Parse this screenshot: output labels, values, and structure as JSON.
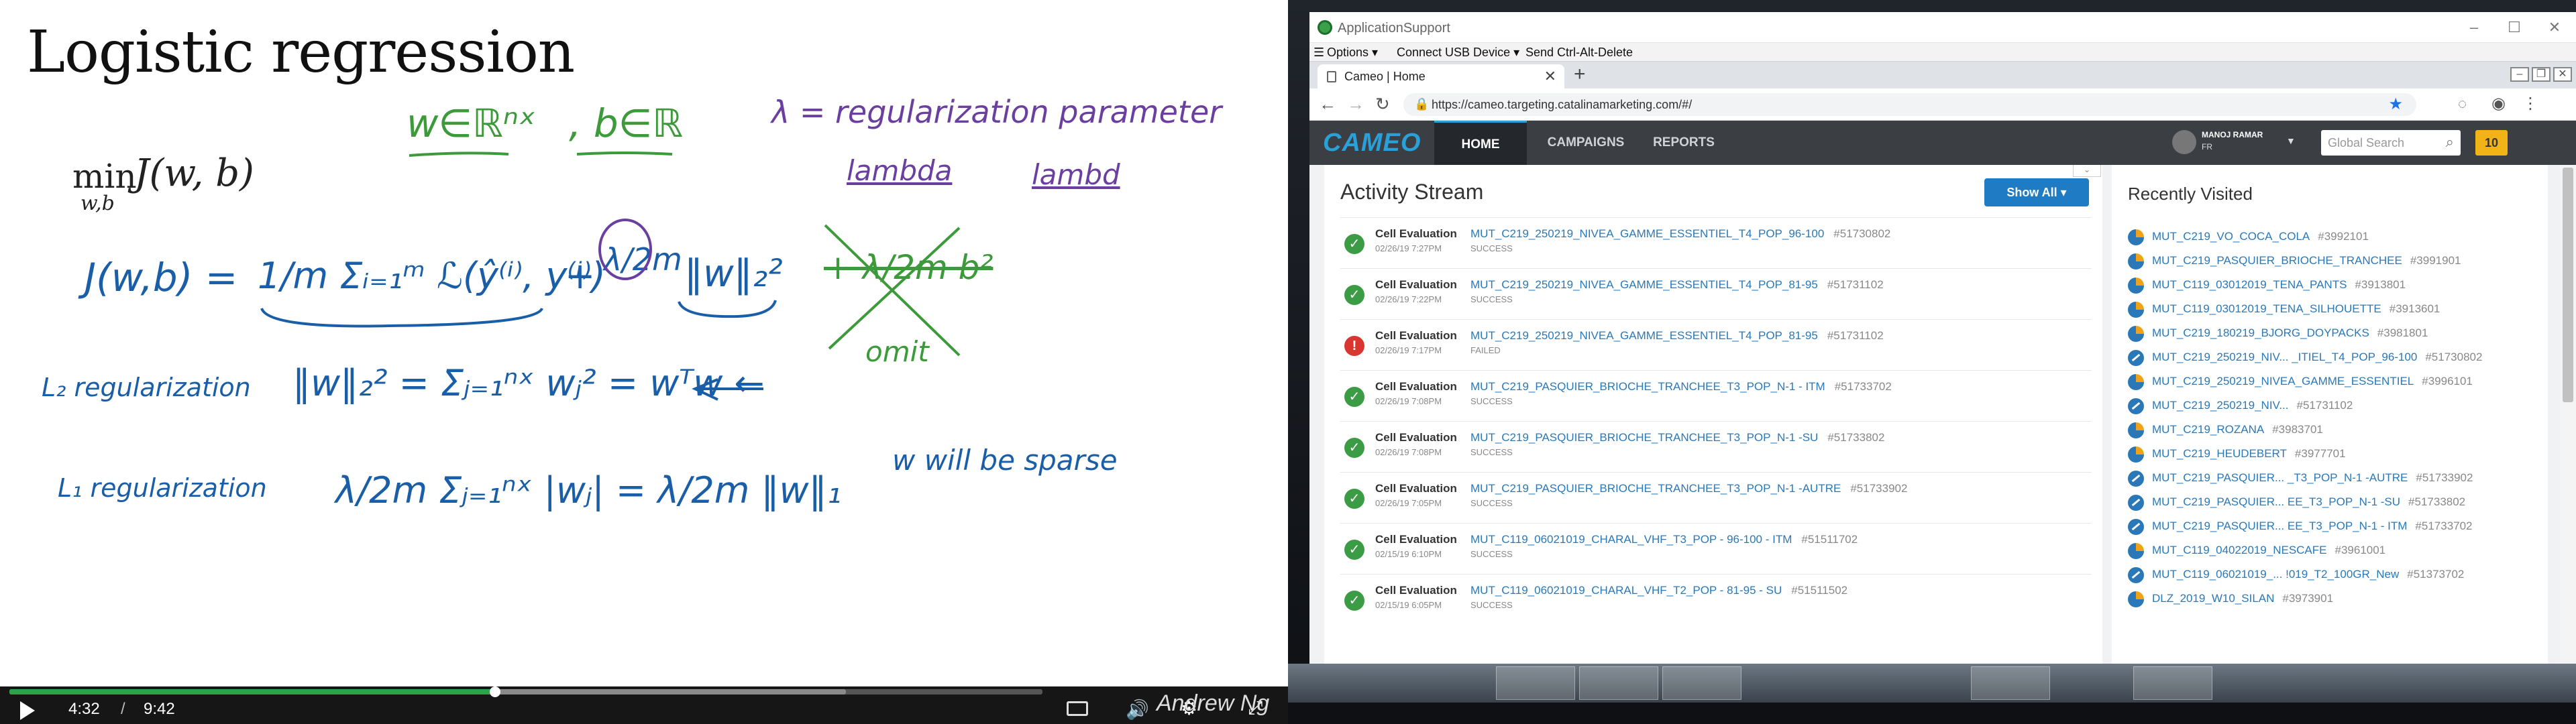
{
  "lecture": {
    "title": "Logistic regression",
    "objective_min": "min",
    "objective_sub": "w,b",
    "objective_expr": "J(w, b)",
    "notes": {
      "w_domain": "w∈ℝⁿˣ",
      "b_domain": ", b∈ℝ",
      "lambda_def": "λ = regularization parameter",
      "lambda_word": "lambda",
      "lambd_word": "lambd",
      "cost_lhs": "J(w,b) = ",
      "cost_sum": "1/m Σᵢ₌₁ᵐ ℒ(ŷ⁽ⁱ⁾, y⁽ⁱ⁾)",
      "cost_plus": "+",
      "cost_lambda": "λ/2m",
      "cost_norm": "‖w‖₂²",
      "omit_term": "+ λ/2m b²",
      "omit_label": "omit",
      "l2_label": "L₂ regularization",
      "l2_formula": "‖w‖₂² = Σⱼ₌₁ⁿˣ wⱼ² = wᵀw ←",
      "l1_label": "L₁ regularization",
      "l1_formula": "λ/2m Σⱼ₌₁ⁿˣ |wⱼ| = λ/2m ‖w‖₁",
      "sparse_note": "w will be sparse"
    },
    "player": {
      "current_time": "4:32",
      "separator": "/",
      "total_time": "9:42",
      "played_fraction": 0.47,
      "buffered_fraction": 0.81,
      "presenter": "Andrew Ng"
    }
  },
  "app_window": {
    "title": "ApplicationSupport",
    "window_controls": [
      "–",
      "☐",
      "✕"
    ],
    "menu": {
      "options": "Options ▾",
      "usb": "Connect USB Device ▾",
      "cad": "Send Ctrl-Alt-Delete"
    }
  },
  "browser": {
    "tab_title": "Cameo | Home",
    "tab_close": "✕",
    "new_tab": "+",
    "url": "https://cameo.targeting.catalinamarketing.com/#/",
    "nav_icons": [
      "back-icon",
      "forward-icon",
      "reload-icon"
    ]
  },
  "cameo": {
    "logo": "CAMEO",
    "nav": [
      "HOME",
      "CAMPAIGNS",
      "REPORTS"
    ],
    "active_nav": "HOME",
    "user_name": "MANOJ RAMAR",
    "user_locale": "FR",
    "search_placeholder": "Global Search",
    "notification_count": "10",
    "activity": {
      "heading": "Activity Stream",
      "show_all": "Show All ▾",
      "rows": [
        {
          "type": "Cell Evaluation",
          "name": "MUT_C219_250219_NIVEA_GAMME_ESSENTIEL_T4_POP_96-100",
          "id": "#51730802",
          "time": "02/26/19 7:27PM",
          "state": "SUCCESS",
          "status": "ok"
        },
        {
          "type": "Cell Evaluation",
          "name": "MUT_C219_250219_NIVEA_GAMME_ESSENTIEL_T4_POP_81-95",
          "id": "#51731102",
          "time": "02/26/19 7:22PM",
          "state": "SUCCESS",
          "status": "ok"
        },
        {
          "type": "Cell Evaluation",
          "name": "MUT_C219_250219_NIVEA_GAMME_ESSENTIEL_T4_POP_81-95",
          "id": "#51731102",
          "time": "02/26/19 7:17PM",
          "state": "FAILED",
          "status": "fail"
        },
        {
          "type": "Cell Evaluation",
          "name": "MUT_C219_PASQUIER_BRIOCHE_TRANCHEE_T3_POP_N-1 - ITM",
          "id": "#51733702",
          "time": "02/26/19 7:08PM",
          "state": "SUCCESS",
          "status": "ok"
        },
        {
          "type": "Cell Evaluation",
          "name": "MUT_C219_PASQUIER_BRIOCHE_TRANCHEE_T3_POP_N-1 -SU",
          "id": "#51733802",
          "time": "02/26/19 7:08PM",
          "state": "SUCCESS",
          "status": "ok"
        },
        {
          "type": "Cell Evaluation",
          "name": "MUT_C219_PASQUIER_BRIOCHE_TRANCHEE_T3_POP_N-1 -AUTRE",
          "id": "#51733902",
          "time": "02/26/19 7:05PM",
          "state": "SUCCESS",
          "status": "ok"
        },
        {
          "type": "Cell Evaluation",
          "name": "MUT_C119_06021019_CHARAL_VHF_T3_POP - 96-100 - ITM",
          "id": "#51511702",
          "time": "02/15/19 6:10PM",
          "state": "SUCCESS",
          "status": "ok"
        },
        {
          "type": "Cell Evaluation",
          "name": "MUT_C119_06021019_CHARAL_VHF_T2_POP - 81-95 - SU",
          "id": "#51511502",
          "time": "02/15/19 6:05PM",
          "state": "SUCCESS",
          "status": "ok"
        }
      ]
    },
    "recent": {
      "heading": "Recently Visited",
      "items": [
        {
          "name": "MUT_C219_VO_COCA_COLA",
          "id": "#3992101",
          "icon": "pie"
        },
        {
          "name": "MUT_C219_PASQUIER_BRIOCHE_TRANCHEE",
          "id": "#3991901",
          "icon": "pie"
        },
        {
          "name": "MUT_C119_03012019_TENA_PANTS",
          "id": "#3913801",
          "icon": "pie"
        },
        {
          "name": "MUT_C119_03012019_TENA_SILHOUETTE",
          "id": "#3913601",
          "icon": "pie"
        },
        {
          "name": "MUT_C219_180219_BJORG_DOYPACKS",
          "id": "#3981801",
          "icon": "pie"
        },
        {
          "name": "MUT_C219_250219_NIV... _ITIEL_T4_POP_96-100",
          "id": "#51730802",
          "icon": "block"
        },
        {
          "name": "MUT_C219_250219_NIVEA_GAMME_ESSENTIEL",
          "id": "#3996101",
          "icon": "pie"
        },
        {
          "name": "MUT_C219_250219_NIV...",
          "id": "#51731102",
          "icon": "block"
        },
        {
          "name": "MUT_C219_ROZANA",
          "id": "#3983701",
          "icon": "pie"
        },
        {
          "name": "MUT_C219_HEUDEBERT",
          "id": "#3977701",
          "icon": "pie"
        },
        {
          "name": "MUT_C219_PASQUIER... _T3_POP_N-1 -AUTRE",
          "id": "#51733902",
          "icon": "block"
        },
        {
          "name": "MUT_C219_PASQUIER... EE_T3_POP_N-1 -SU",
          "id": "#51733802",
          "icon": "block"
        },
        {
          "name": "MUT_C219_PASQUIER... EE_T3_POP_N-1 - ITM",
          "id": "#51733702",
          "icon": "block"
        },
        {
          "name": "MUT_C119_04022019_NESCAFE",
          "id": "#3961001",
          "icon": "pie"
        },
        {
          "name": "MUT_C119_06021019_... !019_T2_100GR_New",
          "id": "#51373702",
          "icon": "block"
        },
        {
          "name": "DLZ_2019_W10_SILAN",
          "id": "#3973901",
          "icon": "pie"
        }
      ]
    }
  },
  "colors": {
    "accent": "#2aa0d8",
    "header_bg": "#3b3f44",
    "link": "#2a78b8",
    "success": "#3c9c45",
    "failure": "#d9362f",
    "badge": "#f2b316",
    "progress": "#2aa34a"
  }
}
